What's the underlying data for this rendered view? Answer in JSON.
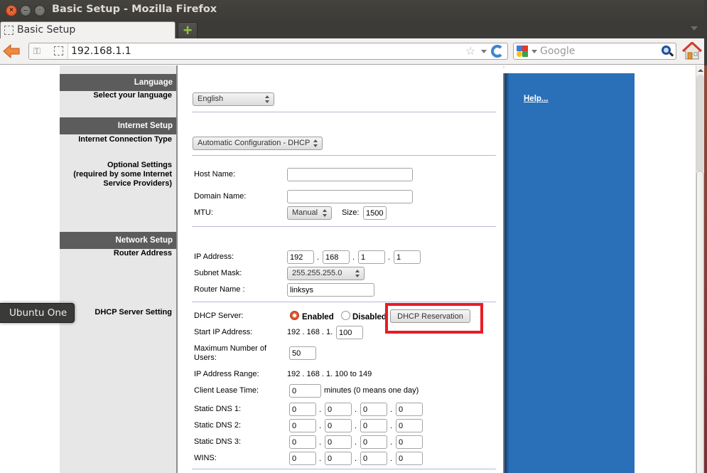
{
  "window": {
    "title": "Basic Setup - Mozilla Firefox",
    "close_glyph": "×",
    "minimize_glyph": "–",
    "maximize_glyph": "▫"
  },
  "tabs": [
    {
      "label": "Basic Setup",
      "active": true
    }
  ],
  "new_tab_glyph": "+",
  "navbar": {
    "url": "192.168.1.1",
    "search_placeholder": "Google",
    "key_icon": "⚿",
    "star_glyph": "☆"
  },
  "launcher_tooltip": "Ubuntu One",
  "page": {
    "help_link": "Help...",
    "sections": [
      {
        "header": "Language",
        "sublabels": [
          "Select your language"
        ]
      },
      {
        "header": "Internet Setup",
        "sublabels": [
          "Internet Connection Type",
          "Optional Settings\n(required by some Internet\nService Providers)"
        ]
      },
      {
        "header": "Network Setup",
        "sublabels": [
          "Router Address",
          "DHCP Server Setting"
        ]
      }
    ],
    "language": {
      "selected": "English"
    },
    "connection_type": {
      "selected": "Automatic Configuration - DHCP"
    },
    "optional": {
      "host_name_label": "Host Name:",
      "host_name_value": "",
      "domain_name_label": "Domain Name:",
      "domain_name_value": "",
      "mtu_label": "MTU:",
      "mtu_mode": "Manual",
      "size_label": "Size:",
      "size_value": "1500"
    },
    "router_address": {
      "ip_label": "IP Address:",
      "ip": [
        "192",
        "168",
        "1",
        "1"
      ],
      "subnet_label": "Subnet Mask:",
      "subnet_value": "255.255.255.0",
      "router_name_label": "Router Name :",
      "router_name_value": "linksys"
    },
    "dhcp": {
      "server_label": "DHCP Server:",
      "enabled_label": "Enabled",
      "disabled_label": "Disabled",
      "server_enabled": true,
      "reservation_button": "DHCP Reservation",
      "start_ip_label": "Start IP Address:",
      "start_ip_prefix": "192 . 168 . 1.",
      "start_ip_last": "100",
      "max_users_label": "Maximum Number of\nUsers:",
      "max_users_value": "50",
      "range_label": "IP Address Range:",
      "range_value": "192 . 168 . 1. 100 to 149",
      "lease_label": "Client Lease Time:",
      "lease_value": "0",
      "lease_suffix": "minutes (0 means one day)",
      "dns": [
        {
          "label": "Static DNS 1:",
          "octets": [
            "0",
            "0",
            "0",
            "0"
          ]
        },
        {
          "label": "Static DNS 2:",
          "octets": [
            "0",
            "0",
            "0",
            "0"
          ]
        },
        {
          "label": "Static DNS 3:",
          "octets": [
            "0",
            "0",
            "0",
            "0"
          ]
        },
        {
          "label": "WINS:",
          "octets": [
            "0",
            "0",
            "0",
            "0"
          ]
        }
      ],
      "octet_separator": "."
    }
  }
}
